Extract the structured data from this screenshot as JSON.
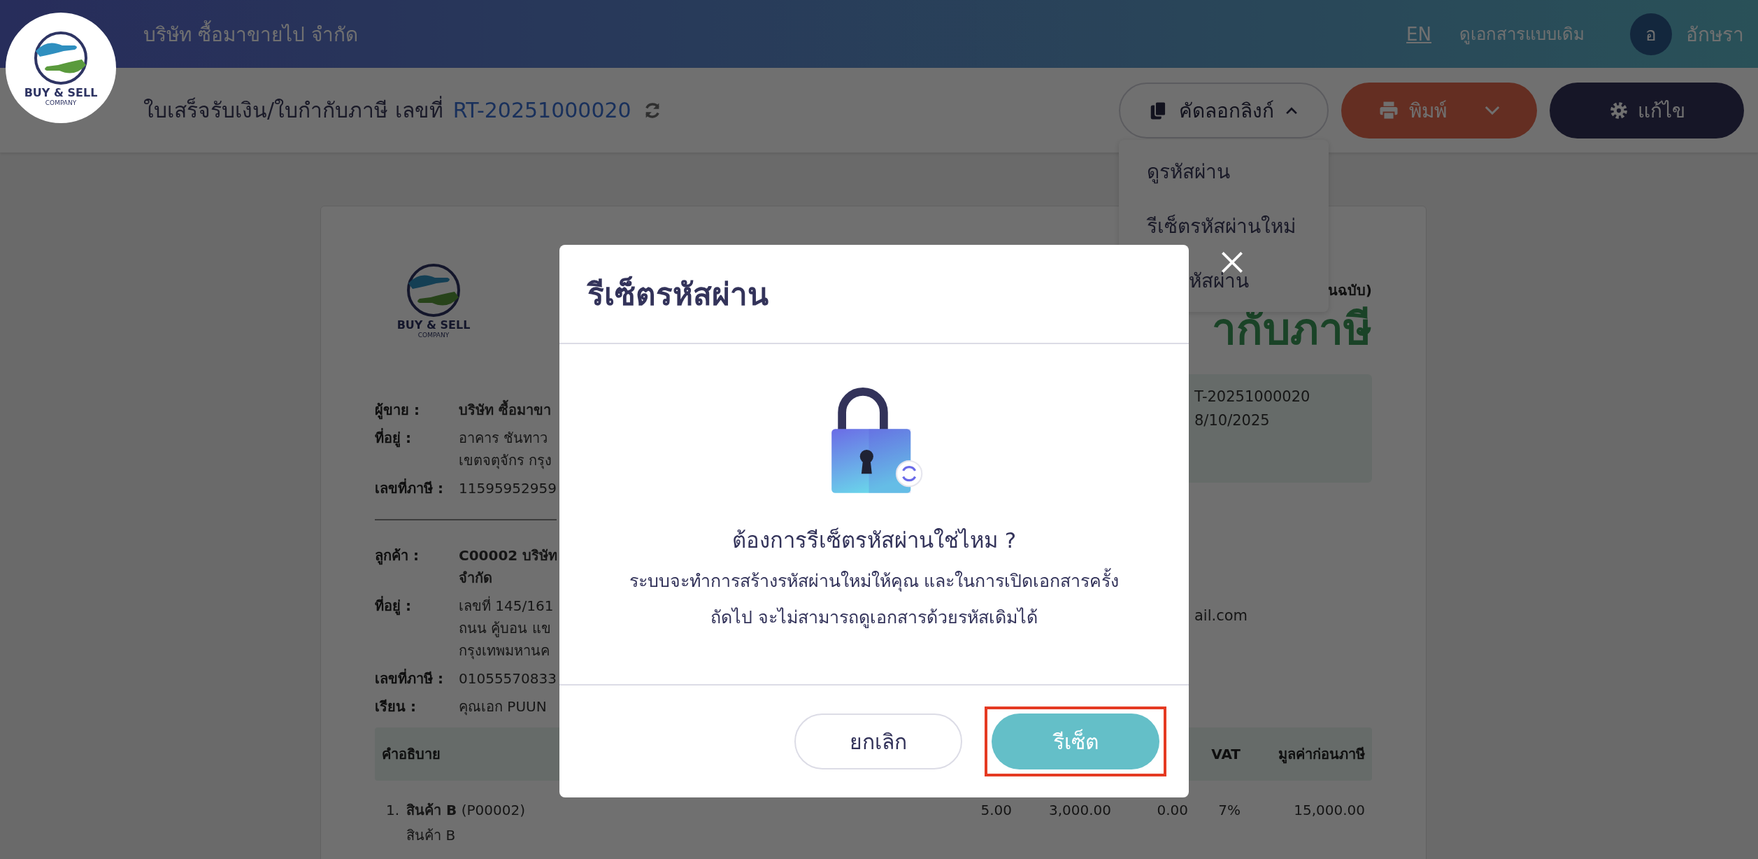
{
  "header": {
    "logo": {
      "name": "BUY & SELL",
      "sub": "COMPANY"
    },
    "company": "บริษัท ซื้อมาขายไป จำกัด",
    "language": "EN",
    "classic_view": "ดูเอกสารแบบเดิม",
    "user": {
      "initial": "อ",
      "name": "อักษรา"
    }
  },
  "toolbar": {
    "title": "ใบเสร็จรับเงิน/ใบกำกับภาษี เลขที่",
    "doc_number": "RT-20251000020",
    "copy_link": {
      "label": "คัดลอกลิงก์",
      "expanded": true
    },
    "print": "พิมพ์",
    "edit": "แก้ไข",
    "menu": [
      "ดูรหัสผ่าน",
      "รีเซ็ตรหัสผ่านใหม่",
      "หัสผ่าน"
    ]
  },
  "document": {
    "logo": {
      "name": "BUY & SELL",
      "sub": "COMPANY"
    },
    "copy_label": "นฉบับ)",
    "title": "ากับภาษี",
    "number": "T-20251000020",
    "date": "8/10/2025",
    "email": "ail.com",
    "seller_info": [
      {
        "label": "ผู้ขาย :",
        "lines": [
          "บริษัท ซื้อมาขา"
        ],
        "bold": true
      },
      {
        "label": "ที่อยู่ :",
        "lines": [
          "อาคาร ชันทาว",
          "เขตจตุจักร กรุง"
        ],
        "bold": false
      },
      {
        "label": "เลขที่ภาษี :",
        "lines": [
          "11595952959"
        ],
        "bold": false
      }
    ],
    "customer_info": [
      {
        "label": "ลูกค้า :",
        "lines": [
          "C00002 บริษัท",
          "จำกัด"
        ],
        "bold": true
      },
      {
        "label": "ที่อยู่ :",
        "lines": [
          "เลขที่ 145/161",
          "ถนน คู้บอน แข",
          "กรุงเทพมหานค"
        ],
        "bold": false
      },
      {
        "label": "เลขที่ภาษี :",
        "lines": [
          "01055570833"
        ],
        "bold": false
      },
      {
        "label": "เรียน :",
        "lines": [
          "คุณเอก PUUN"
        ],
        "bold": false
      }
    ],
    "table": {
      "description_header": "คำอธิบาย",
      "columns": [
        "",
        "",
        "",
        "VAT",
        "มูลค่าก่อนภาษี"
      ],
      "rows": [
        {
          "index": "1.",
          "name": "**สินค้า B** (P00002)",
          "detail": "สินค้า B",
          "cells": [
            "5.00",
            "3,000.00",
            "0.00",
            "7%",
            "15,000.00"
          ]
        }
      ]
    }
  },
  "modal": {
    "title": "รีเซ็ตรหัสผ่าน",
    "question": "ต้องการรีเซ็ตรหัสผ่านใช่ไหม ?",
    "message": [
      "ระบบจะทำการสร้างรหัสผ่านใหม่ให้คุณ และในการเปิดเอกสารครั้ง",
      "ถัดไป จะไม่สามารถดูเอกสารด้วยรหัสเดิมได้"
    ],
    "buttons": [
      {
        "label": "ยกเลิก",
        "kind": "secondary",
        "highlighted": false
      },
      {
        "label": "รีเซ็ต",
        "kind": "primary",
        "highlighted": true
      }
    ]
  }
}
